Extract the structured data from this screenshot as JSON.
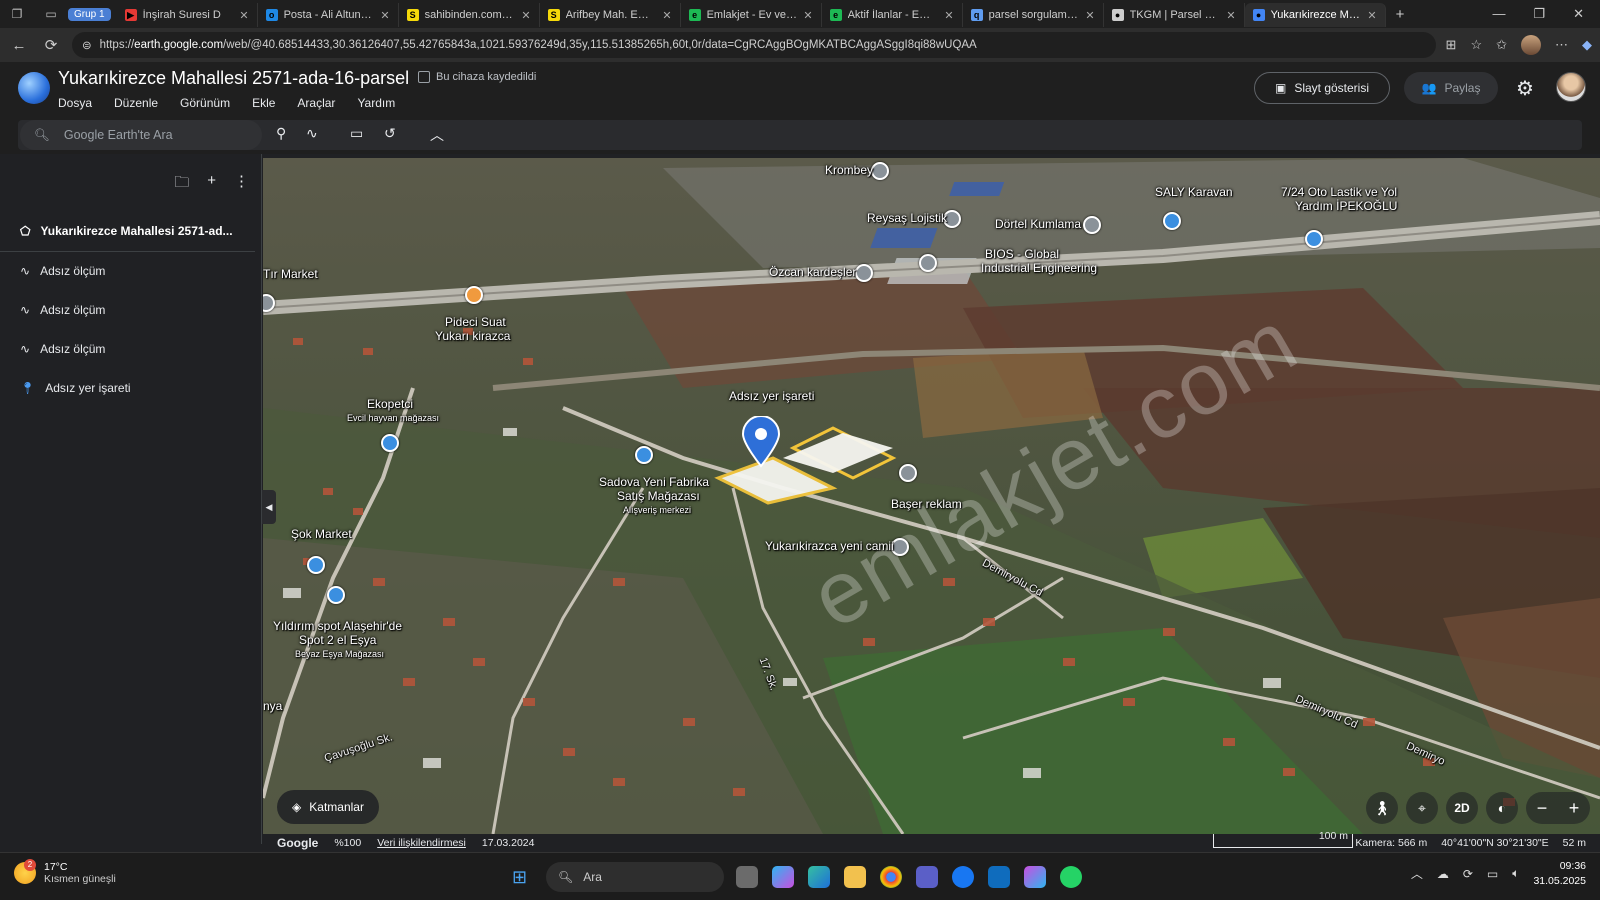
{
  "browser": {
    "group_chip": "Grup 1",
    "tabs": [
      {
        "title": "İnşirah Suresi D",
        "color": "#e53935",
        "glyph": "▶"
      },
      {
        "title": "Posta - Ali Altun - Ou",
        "color": "#1e88e5",
        "glyph": "o"
      },
      {
        "title": "sahibinden.com - Tü",
        "color": "#f5d90a",
        "glyph": "S"
      },
      {
        "title": "Arifbey Mah. Emlak C",
        "color": "#f5d90a",
        "glyph": "S"
      },
      {
        "title": "Emlakjet - Ev ve Dair",
        "color": "#1db954",
        "glyph": "e"
      },
      {
        "title": "Aktif İlanlar - Emlakje",
        "color": "#1db954",
        "glyph": "e"
      },
      {
        "title": "parsel sorgulam - Ar",
        "color": "#5f9cf0",
        "glyph": "q"
      },
      {
        "title": "TKGM | Parsel Sorgu",
        "color": "#cccccc",
        "glyph": "●"
      },
      {
        "title": "Yukarıkirezce Mahalle",
        "color": "#4285f4",
        "glyph": "●"
      }
    ],
    "url_prefix": "https://",
    "url_host": "earth.google.com",
    "url_rest": "/web/@40.68514433,30.36126407,55.42765843a,1021.59376249d,35y,115.51385265h,60t,0r/data=CgRCAggBOgMKATBCAggASggI8qi88wUQAA"
  },
  "app": {
    "project_title": "Yukarıkirezce Mahallesi 2571-ada-16-parsel",
    "saved_note": "Bu cihaza kaydedildi",
    "menu": [
      "Dosya",
      "Düzenle",
      "Görünüm",
      "Ekle",
      "Araçlar",
      "Yardım"
    ],
    "slideshow_label": "Slayt gösterisi",
    "share_label": "Paylaş",
    "search_placeholder": "Google Earth'te Ara"
  },
  "sidebar": {
    "project_item": "Yukarıkirezce Mahallesi 2571-ad...",
    "items": [
      {
        "label": "Adsız ölçüm",
        "icon": "path-icon"
      },
      {
        "label": "Adsız ölçüm",
        "icon": "path-icon"
      },
      {
        "label": "Adsız ölçüm",
        "icon": "path-icon"
      },
      {
        "label": "Adsız yer işareti",
        "icon": "placemark-icon"
      }
    ]
  },
  "map": {
    "labels": {
      "krombey": "Krombey",
      "saly": "SALY Karavan",
      "oto_lastik_1": "7/24 Oto Lastik ve Yol",
      "oto_lastik_2": "Yardım İPEKOĞLU",
      "reysas": "Reysaş Lojistik",
      "dortel": "Dörtel Kumlama",
      "bios_1": "BIOS - Global",
      "bios_2": "Industrial Engineering",
      "ozcan": "Özcan kardeşler",
      "tir_market": "Tır Market",
      "pideci_1": "Pideci Suat",
      "pideci_2": "Yukarı kirazca",
      "placemark": "Adsız yer işareti",
      "ekopetci": "Ekopetci",
      "ekopetci_sub": "Evcil hayvan mağazası",
      "sadova_1": "Sadova Yeni Fabrika",
      "sadova_2": "Satış Mağazası",
      "sadova_sub": "Alışveriş merkezi",
      "baser": "Başer reklam",
      "camii": "Yukarıkirazca yeni camii",
      "sok": "Şok Market",
      "yildirim_1": "Yıldırım spot Alaşehir'de",
      "yildirim_2": "Spot 2 el Eşya",
      "yildirim_sub": "Beyaz Eşya Mağazası",
      "demiryolu_1": "Demiryolu Cd",
      "demiryolu_2": "Demiryolu Cd",
      "demiryolu_3": "Demiryo",
      "sk17": "17. Sk.",
      "cavusoglu": "Çavuşoğlu Sk.",
      "nya": "nya"
    },
    "watermark": "emlakjet.com",
    "layers_label": "Katmanlar",
    "mode_2d": "2D"
  },
  "status": {
    "brand": "Google",
    "zoom": "%100",
    "attribution": "Veri ilişkilendirmesi",
    "date": "17.03.2024",
    "scale": "100 m",
    "camera": "Kamera: 566 m",
    "coords": "40°41'00\"N 30°21'30\"E",
    "elevation": "52 m"
  },
  "taskbar": {
    "temp": "17°C",
    "condition": "Kısmen güneşli",
    "weather_badge": "2",
    "search_label": "Ara",
    "time": "09:36",
    "date": "31.05.2025"
  }
}
